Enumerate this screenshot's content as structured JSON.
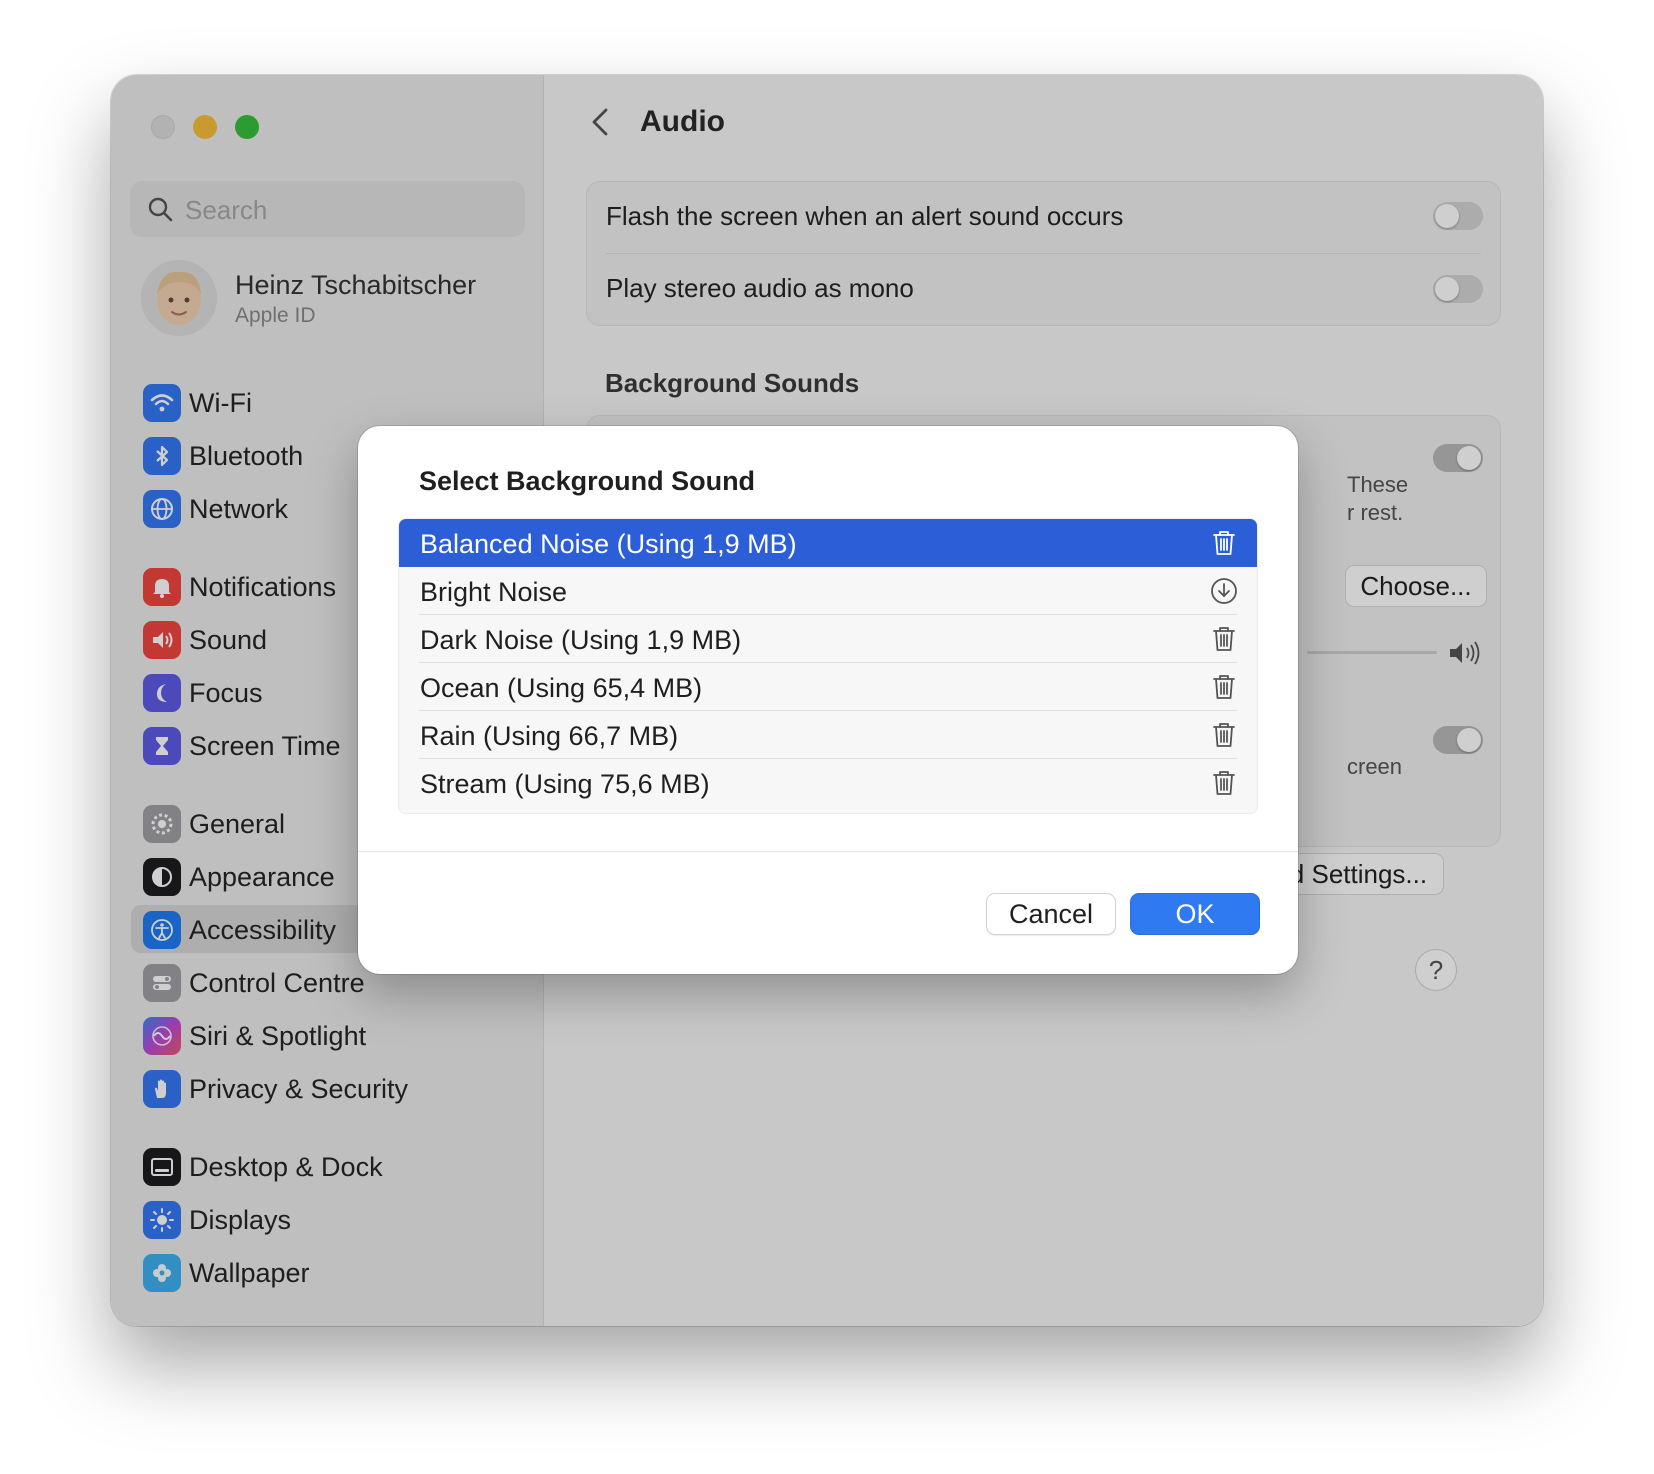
{
  "window": {
    "traffic_lights": {
      "close": "#dcdcdc",
      "minimize": "#f7be3c",
      "maximize": "#37c13e"
    }
  },
  "sidebar": {
    "search": {
      "placeholder": "Search",
      "icon": "search-icon"
    },
    "account": {
      "name": "Heinz Tschabitscher",
      "subtitle": "Apple ID"
    },
    "items": [
      {
        "id": "wifi",
        "label": "Wi-Fi",
        "icon": "wifi-icon",
        "color": "#3478f6"
      },
      {
        "id": "bluetooth",
        "label": "Bluetooth",
        "icon": "bluetooth-icon",
        "color": "#3478f6"
      },
      {
        "id": "network",
        "label": "Network",
        "icon": "globe-icon",
        "color": "#3478f6"
      },
      {
        "id": "notifications",
        "label": "Notifications",
        "icon": "bell-icon",
        "color": "#f0463e"
      },
      {
        "id": "sound",
        "label": "Sound",
        "icon": "speaker-icon",
        "color": "#f0463e"
      },
      {
        "id": "focus",
        "label": "Focus",
        "icon": "moon-icon",
        "color": "#5e5ce6"
      },
      {
        "id": "screen-time",
        "label": "Screen Time",
        "icon": "hourglass-icon",
        "color": "#5e5ce6"
      },
      {
        "id": "general",
        "label": "General",
        "icon": "gear-icon",
        "color": "#a0a0a5"
      },
      {
        "id": "appearance",
        "label": "Appearance",
        "icon": "appearance-icon",
        "color": "#1d1d1f"
      },
      {
        "id": "accessibility",
        "label": "Accessibility",
        "icon": "accessibility-icon",
        "color": "#1f7cf5"
      },
      {
        "id": "control-centre",
        "label": "Control Centre",
        "icon": "switches-icon",
        "color": "#a0a0a5"
      },
      {
        "id": "siri",
        "label": "Siri & Spotlight",
        "icon": "siri-icon",
        "color": "#b04fd8"
      },
      {
        "id": "privacy",
        "label": "Privacy & Security",
        "icon": "hand-icon",
        "color": "#3478f6"
      },
      {
        "id": "desktop-dock",
        "label": "Desktop & Dock",
        "icon": "dock-icon",
        "color": "#1d1d1f"
      },
      {
        "id": "displays",
        "label": "Displays",
        "icon": "sun-icon",
        "color": "#3478f6"
      },
      {
        "id": "wallpaper",
        "label": "Wallpaper",
        "icon": "flower-icon",
        "color": "#3fb1f0"
      }
    ],
    "active_item": "accessibility"
  },
  "content": {
    "title": "Audio",
    "rows": [
      {
        "label": "Flash the screen when an alert sound occurs",
        "on": false
      },
      {
        "label": "Play stereo audio as mono",
        "on": false
      }
    ],
    "section_title": "Background Sounds",
    "partial": {
      "these_text": "These",
      "rest_text": "r rest.",
      "se_text": "se",
      "choose_button": "Choose...",
      "screen_text": "creen",
      "settings_button": "und Settings...",
      "help": "?"
    }
  },
  "dialog": {
    "title": "Select Background Sound",
    "sounds": [
      {
        "label": "Balanced Noise (Using 1,9 MB)",
        "action_icon": "trash-icon",
        "selected": true
      },
      {
        "label": "Bright Noise",
        "action_icon": "download-icon",
        "selected": false
      },
      {
        "label": "Dark Noise (Using 1,9 MB)",
        "action_icon": "trash-icon",
        "selected": false
      },
      {
        "label": "Ocean (Using 65,4 MB)",
        "action_icon": "trash-icon",
        "selected": false
      },
      {
        "label": "Rain (Using 66,7 MB)",
        "action_icon": "trash-icon",
        "selected": false
      },
      {
        "label": "Stream (Using 75,6 MB)",
        "action_icon": "trash-icon",
        "selected": false
      }
    ],
    "cancel_label": "Cancel",
    "ok_label": "OK",
    "accent": "#2c5fd7"
  }
}
